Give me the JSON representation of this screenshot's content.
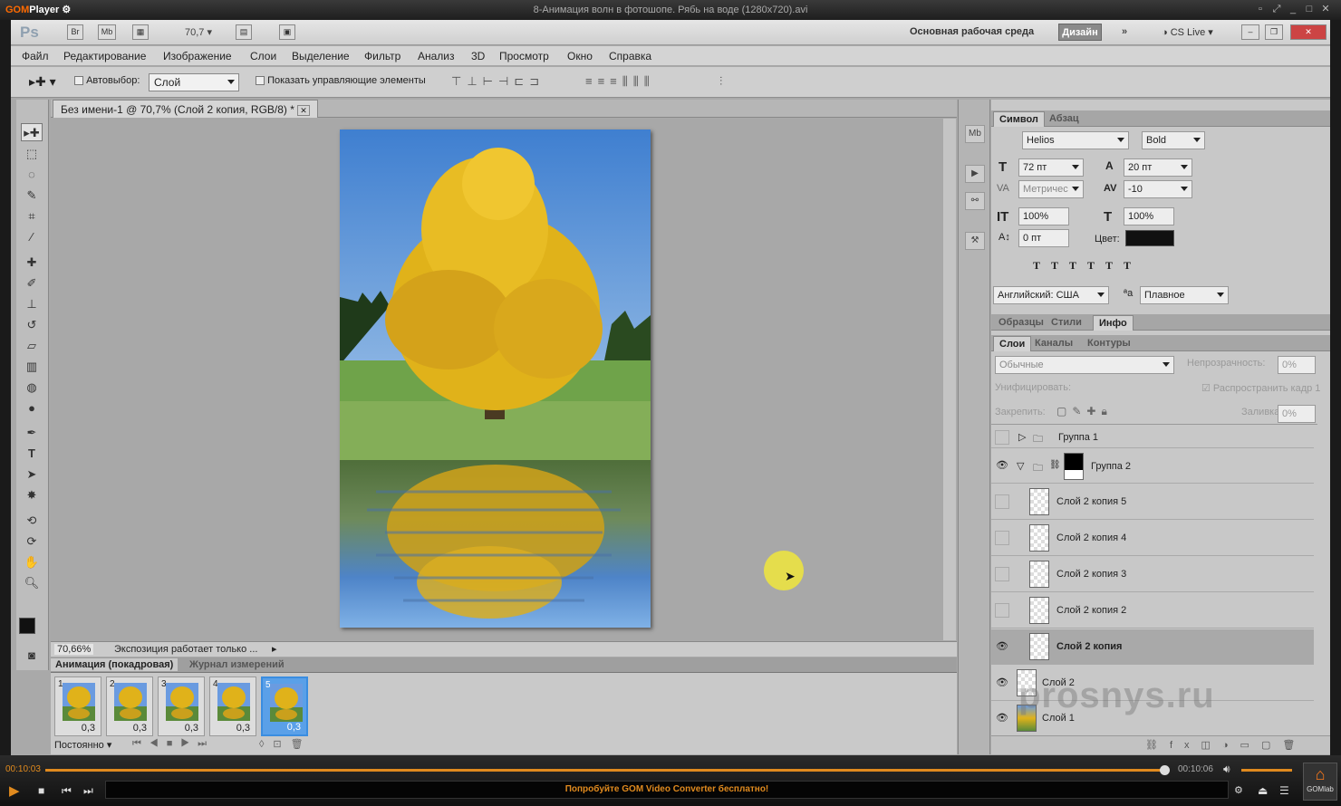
{
  "gom": {
    "logo": "GOM",
    "logo2": "Player",
    "title": "8-Анимация волн в фотошопе. Рябь на воде (1280x720).avi",
    "time_current": "00:10:03",
    "time_total": "00:10:06",
    "promo": "Попробуйте GOM Video Converter бесплатно!",
    "gomlab": "GOMlab",
    "progress": 0.997
  },
  "appbar": {
    "logo": "Ps",
    "br": "Br",
    "mb": "Mb",
    "zoom": "70,7",
    "workspace": "Основная рабочая среда",
    "design": "Дизайн",
    "cslive": "CS Live"
  },
  "menu": [
    "Файл",
    "Редактирование",
    "Изображение",
    "Слои",
    "Выделение",
    "Фильтр",
    "Анализ",
    "3D",
    "Просмотр",
    "Окно",
    "Справка"
  ],
  "options": {
    "autoselect": "Автовыбор:",
    "layer_select": "Слой",
    "show_controls": "Показать управляющие элементы"
  },
  "document": {
    "tab": "Без имени-1 @ 70,7% (Слой 2 копия, RGB/8) *",
    "zoom": "70,66%",
    "status": "Экспозиция работает только ..."
  },
  "animation": {
    "tab1": "Анимация (покадровая)",
    "tab2": "Журнал измерений",
    "frames": [
      {
        "n": "1",
        "d": "0,3"
      },
      {
        "n": "2",
        "d": "0,3"
      },
      {
        "n": "3",
        "d": "0,3"
      },
      {
        "n": "4",
        "d": "0,3"
      },
      {
        "n": "5",
        "d": "0,3"
      }
    ],
    "loop": "Постоянно"
  },
  "character": {
    "tab1": "Символ",
    "tab2": "Абзац",
    "font": "Helios",
    "style": "Bold",
    "size": "72 пт",
    "leading": "20 пт",
    "kerning": "Метричес",
    "tracking": "-10",
    "vscale": "100%",
    "hscale": "100%",
    "baseline": "0 пт",
    "color_label": "Цвет:",
    "language": "Английский: США",
    "aa_label": "a",
    "antialias": "Плавное"
  },
  "swatches": {
    "tab1": "Образцы",
    "tab2": "Стили",
    "tab3": "Инфо"
  },
  "layers": {
    "tab1": "Слои",
    "tab2": "Каналы",
    "tab3": "Контуры",
    "blend": "Обычные",
    "opacity_label": "Непрозрачность:",
    "opacity": "0%",
    "unify_label": "Унифицировать:",
    "propagate": "Распространить кадр 1",
    "lock_label": "Закрепить:",
    "fill_label": "Заливка:",
    "fill": "0%",
    "items": [
      {
        "name": "Группа 1",
        "visible": false,
        "type": "group",
        "expanded": false
      },
      {
        "name": "Группа 2",
        "visible": true,
        "type": "group",
        "expanded": true
      },
      {
        "name": "Слой 2 копия 5",
        "visible": false,
        "type": "layer"
      },
      {
        "name": "Слой 2 копия 4",
        "visible": false,
        "type": "layer"
      },
      {
        "name": "Слой 2 копия 3",
        "visible": false,
        "type": "layer"
      },
      {
        "name": "Слой 2 копия 2",
        "visible": false,
        "type": "layer"
      },
      {
        "name": "Слой 2 копия",
        "visible": true,
        "type": "layer",
        "selected": true
      },
      {
        "name": "Слой 2",
        "visible": true,
        "type": "layer"
      },
      {
        "name": "Слой 1",
        "visible": true,
        "type": "layer"
      }
    ]
  },
  "watermark": "prosnys.ru",
  "colors": {
    "accent": "#e08a1e",
    "design_btn": "#8a8a8a"
  }
}
